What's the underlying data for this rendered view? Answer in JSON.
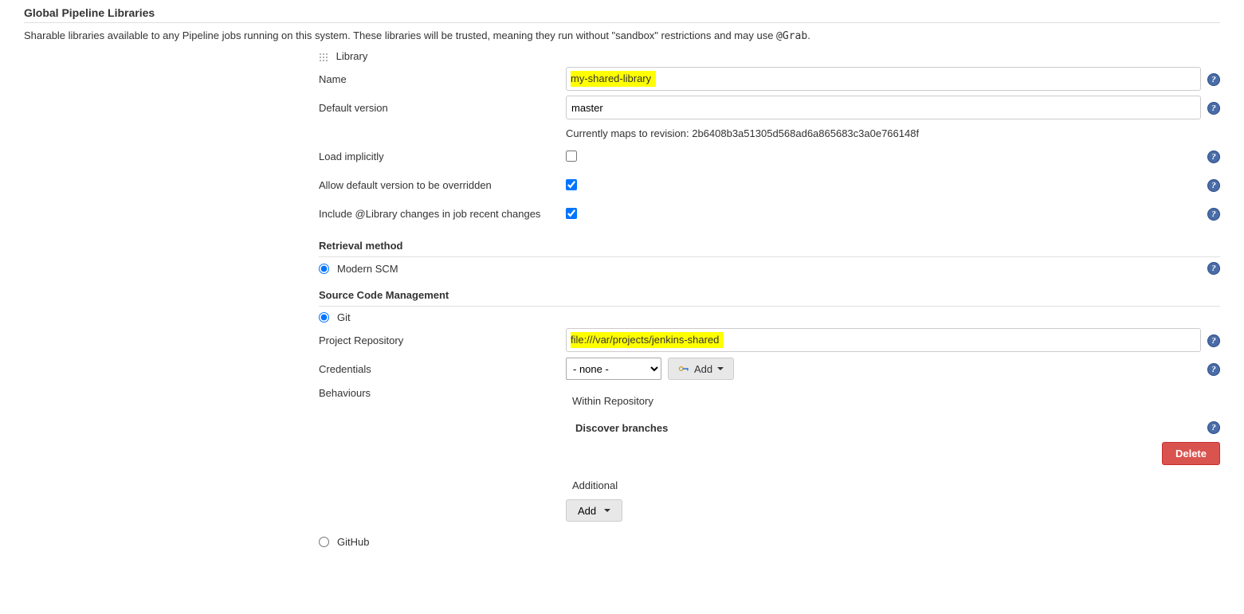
{
  "section": {
    "title": "Global Pipeline Libraries",
    "description_pre": "Sharable libraries available to any Pipeline jobs running on this system. These libraries will be trusted, meaning they run without \"sandbox\" restrictions and may use ",
    "description_code": "@Grab",
    "description_post": "."
  },
  "library": {
    "label": "Library",
    "name_label": "Name",
    "name_value": "my-shared-library",
    "default_version_label": "Default version",
    "default_version_value": "master",
    "revision_hint": "Currently maps to revision: 2b6408b3a51305d568ad6a865683c3a0e766148f",
    "load_implicitly_label": "Load implicitly",
    "load_implicitly_checked": false,
    "allow_override_label": "Allow default version to be overridden",
    "allow_override_checked": true,
    "include_changes_label": "Include @Library changes in job recent changes",
    "include_changes_checked": true
  },
  "retrieval": {
    "title": "Retrieval method",
    "modern_scm_label": "Modern SCM",
    "modern_scm_checked": true
  },
  "scm": {
    "title": "Source Code Management",
    "git_label": "Git",
    "git_checked": true,
    "github_label": "GitHub",
    "github_checked": false,
    "repo_label": "Project Repository",
    "repo_value": "file:///var/projects/jenkins-shared",
    "credentials_label": "Credentials",
    "credentials_value": "- none -",
    "add_label": "Add",
    "behaviours_label": "Behaviours",
    "within_repo_label": "Within Repository",
    "discover_branches_label": "Discover branches",
    "delete_label": "Delete",
    "additional_label": "Additional",
    "add2_label": "Add"
  },
  "help_glyph": "?"
}
